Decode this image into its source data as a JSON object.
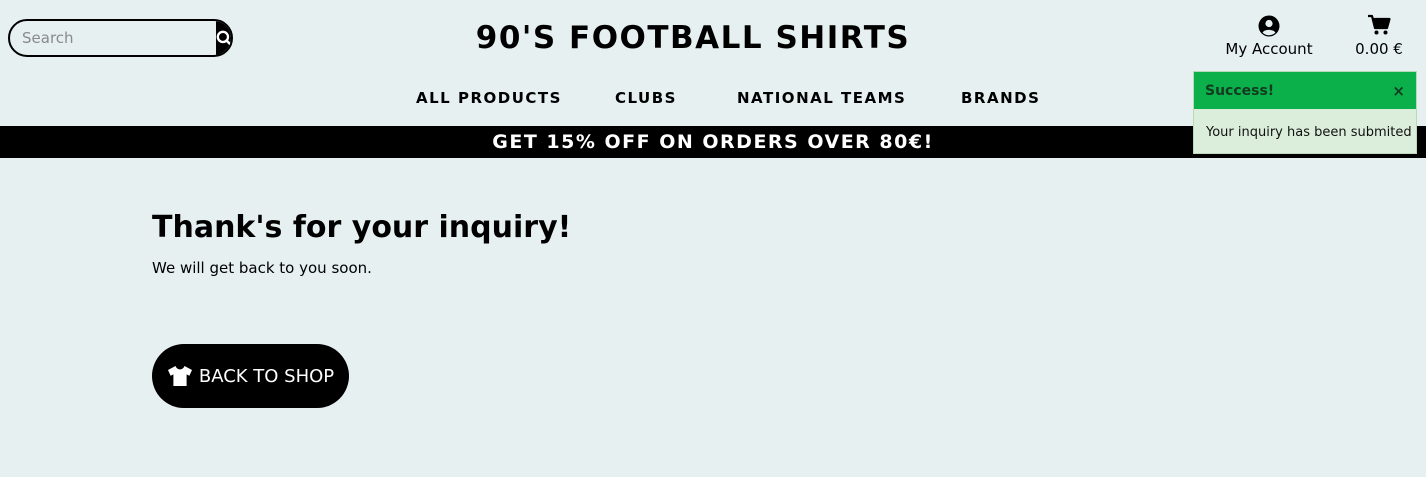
{
  "header": {
    "search_placeholder": "Search",
    "site_title": "90'S FOOTBALL SHIRTS",
    "account_label": "My Account",
    "cart_total": "0.00 €"
  },
  "nav": {
    "items": [
      "ALL PRODUCTS",
      "CLUBS",
      "NATIONAL TEAMS",
      "BRANDS"
    ]
  },
  "promo": {
    "text": "GET 15% OFF ON ORDERS OVER 80€!"
  },
  "main": {
    "heading": "Thank's for your inquiry!",
    "subtext": "We will get back to you soon.",
    "back_button_label": "BACK TO SHOP"
  },
  "toast": {
    "title": "Success!",
    "close_symbol": "×",
    "message": "Your inquiry has been submited"
  },
  "colors": {
    "background": "#e6f0f0",
    "toast_header": "#0bb04a",
    "toast_body": "#dbeedb",
    "primary": "#000000"
  },
  "icons": {
    "search": "search-icon",
    "account": "user-circle-icon",
    "cart": "cart-icon",
    "shirt": "shirt-icon"
  }
}
